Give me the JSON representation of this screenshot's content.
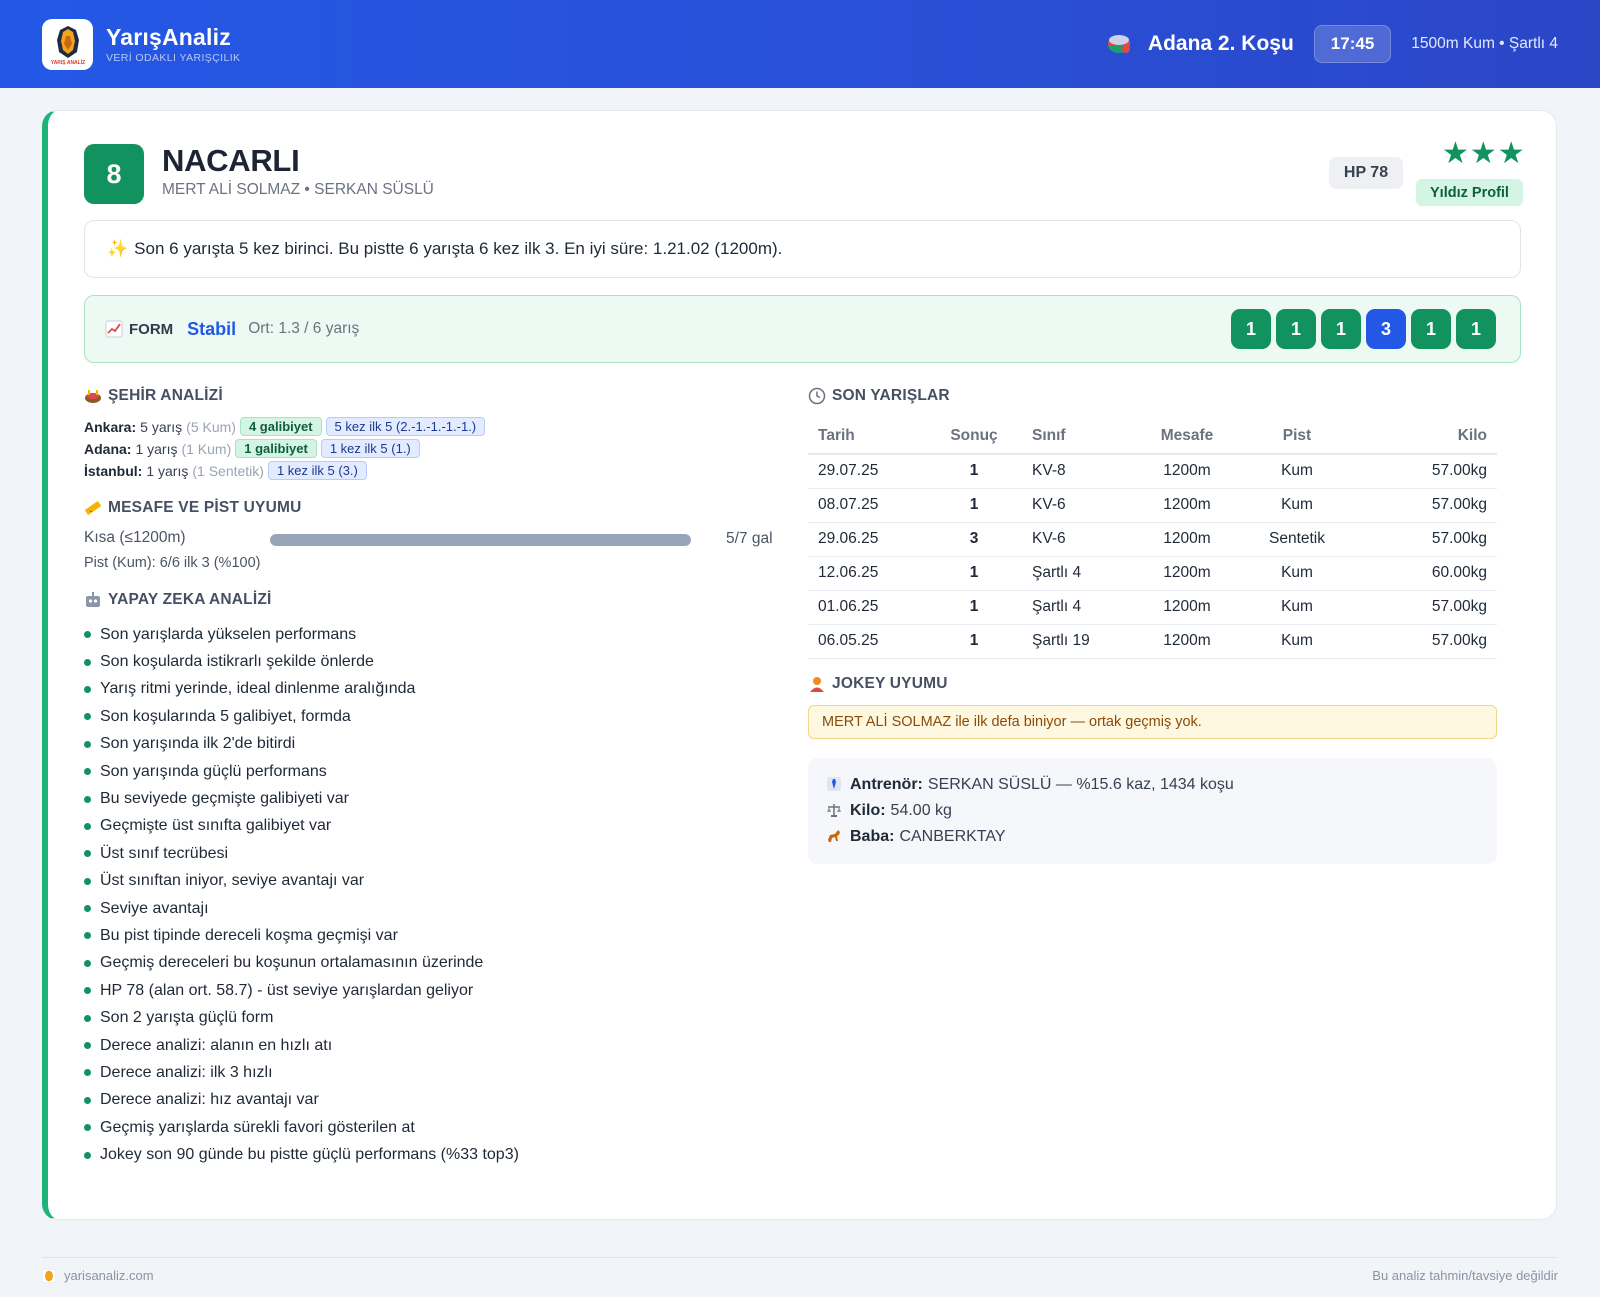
{
  "brand": {
    "name": "YarışAnaliz",
    "tagline": "VERİ ODAKLI YARIŞÇILIK",
    "logo_icon": "horse-head-icon",
    "logo_text": "YARIŞ ANALİZ"
  },
  "race": {
    "icon": "jockey-cap-icon",
    "title": "Adana 2. Koşu",
    "time": "17:45",
    "meta": "1500m Kum • Şartlı 4"
  },
  "horse": {
    "number": "8",
    "name": "NACARLI",
    "connections": "MERT ALİ SOLMAZ • SERKAN SÜSLÜ",
    "hp": "HP 78",
    "stars": "★★★",
    "star_label": "Yıldız Profil",
    "accent": "#1fb37a"
  },
  "summary": {
    "icon": "✨",
    "text": "Son 6 yarışta 5 kez birinci. Bu pistte 6 yarışta 6 kez ilk 3. En iyi süre: 1.21.02 (1200m)."
  },
  "form": {
    "label": "FORM",
    "trend": "Stabil",
    "avg": "Ort: 1.3 / 6 yarış",
    "results": [
      {
        "v": "1",
        "color": "#12925e"
      },
      {
        "v": "1",
        "color": "#12925e"
      },
      {
        "v": "1",
        "color": "#12925e"
      },
      {
        "v": "3",
        "color": "#2358e6"
      },
      {
        "v": "1",
        "color": "#12925e"
      },
      {
        "v": "1",
        "color": "#12925e"
      }
    ]
  },
  "city": {
    "title": "ŞEHİR ANALİZİ",
    "rows": [
      {
        "city": "Ankara:",
        "races": "5 yarış",
        "surface": "(5 Kum)",
        "wins": "4 galibiyet",
        "top": "5 kez ilk 5 (2.-1.-1.-1.-1.)"
      },
      {
        "city": "Adana:",
        "races": "1 yarış",
        "surface": "(1 Kum)",
        "wins": "1 galibiyet",
        "top": "1 kez ilk 5 (1.)"
      },
      {
        "city": "İstanbul:",
        "races": "1 yarış",
        "surface": "(1 Sentetik)",
        "wins": "",
        "top": "1 kez ilk 5 (3.)"
      }
    ]
  },
  "distance": {
    "title": "MESAFE VE PİST UYUMU",
    "label": "Kısa (≤1200m)",
    "fraction": 1.0,
    "value": "5/7 gal",
    "pist": "Pist (Kum): 6/6 ilk 3 (%100)"
  },
  "ai": {
    "title": "YAPAY ZEKA ANALİZİ",
    "items": [
      "Son yarışlarda yükselen performans",
      "Son koşularda istikrarlı şekilde önlerde",
      "Yarış ritmi yerinde, ideal dinlenme aralığında",
      "Son koşularında 5 galibiyet, formda",
      "Son yarışında ilk 2'de bitirdi",
      "Son yarışında güçlü performans",
      "Bu seviyede geçmişte galibiyeti var",
      "Geçmişte üst sınıfta galibiyet var",
      "Üst sınıf tecrübesi",
      "Üst sınıftan iniyor, seviye avantajı var",
      "Seviye avantajı",
      "Bu pist tipinde dereceli koşma geçmişi var",
      "Geçmiş dereceleri bu koşunun ortalamasının üzerinde",
      "HP 78 (alan ort. 58.7) - üst seviye yarışlardan geliyor",
      "Son 2 yarışta güçlü form",
      "Derece analizi: alanın en hızlı atı",
      "Derece analizi: ilk 3 hızlı",
      "Derece analizi: hız avantajı var",
      "Geçmiş yarışlarda sürekli favori gösterilen at",
      "Jokey son 90 günde bu pistte güçlü performans (%33 top3)"
    ]
  },
  "recent": {
    "title": "SON YARIŞLAR",
    "headers": [
      "Tarih",
      "Sonuç",
      "Sınıf",
      "Mesafe",
      "Pist",
      "Kilo"
    ],
    "rows": [
      [
        "29.07.25",
        "1",
        "KV-8",
        "1200m",
        "Kum",
        "57.00kg"
      ],
      [
        "08.07.25",
        "1",
        "KV-6",
        "1200m",
        "Kum",
        "57.00kg"
      ],
      [
        "29.06.25",
        "3",
        "KV-6",
        "1200m",
        "Sentetik",
        "57.00kg"
      ],
      [
        "12.06.25",
        "1",
        "Şartlı 4",
        "1200m",
        "Kum",
        "60.00kg"
      ],
      [
        "01.06.25",
        "1",
        "Şartlı 4",
        "1200m",
        "Kum",
        "57.00kg"
      ],
      [
        "06.05.25",
        "1",
        "Şartlı 19",
        "1200m",
        "Kum",
        "57.00kg"
      ]
    ]
  },
  "jockey": {
    "title": "JOKEY UYUMU",
    "note": "MERT ALİ SOLMAZ ile ilk defa biniyor — ortak geçmiş yok."
  },
  "info": {
    "trainer_label": "Antrenör:",
    "trainer_value": "SERKAN SÜSLÜ — %15.6 kaz, 1434 koşu",
    "weight_label": "Kilo:",
    "weight_value": "54.00 kg",
    "sire_label": "Baba:",
    "sire_value": "CANBERKTAY"
  },
  "footer": {
    "site": "yarisanaliz.com",
    "disclaimer": "Bu analiz tahmin/tavsiye değildir"
  }
}
